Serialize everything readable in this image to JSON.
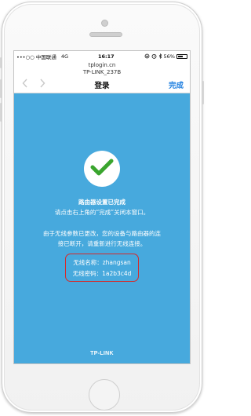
{
  "status_bar": {
    "carrier": "•••○○ 中国联通",
    "network": "4G",
    "time": "16:17",
    "battery_percent": "56%",
    "battery_level": 0.56,
    "icons": [
      "lock-rotation-icon",
      "alarm-icon",
      "bluetooth-icon"
    ]
  },
  "address_bar": {
    "url": "tplogin.cn",
    "page_title": "TP-LINK_237B"
  },
  "nav": {
    "back_icon": "chevron-left-icon",
    "forward_icon": "chevron-right-icon",
    "title": "登录",
    "done": "完成"
  },
  "content": {
    "success_icon": "checkmark-icon",
    "heading": "路由器设置已完成",
    "instruction": "请点击右上角的“完成”关闭本窗口。",
    "notice_line1": "由于无线参数已更改，您的设备与路由器的连",
    "notice_line2": "接已断开，请重新进行无线连接。",
    "wifi_name_label": "无线名称：",
    "wifi_name": "zhangsan",
    "wifi_password_label": "无线密码：",
    "wifi_password": "1a2b3c4d"
  },
  "footer": {
    "logo": "TP-LINK"
  },
  "colors": {
    "background": "#47a9dd",
    "accent": "#1f7fe0",
    "highlight_border": "#d62a2a",
    "check": "#3aa52e"
  }
}
